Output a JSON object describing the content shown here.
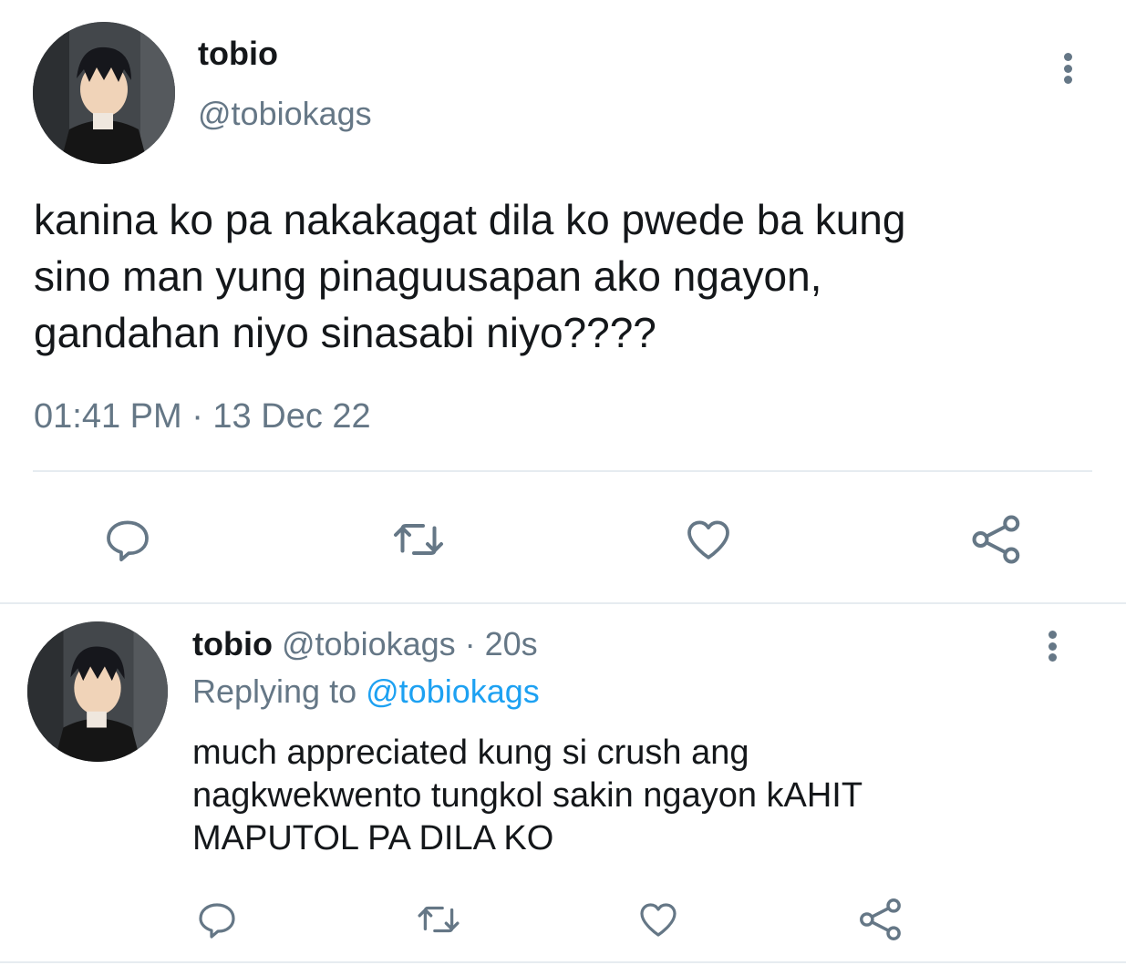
{
  "main_tweet": {
    "display_name": "tobio",
    "handle": "@tobiokags",
    "text_lines": [
      "kanina ko pa nakakagat dila ko pwede ba kung",
      "sino man yung pinaguusapan ako ngayon,",
      "gandahan niyo sinasabi niyo????"
    ],
    "timestamp": "01:41 PM · 13 Dec 22",
    "actions": [
      "reply-icon",
      "retweet-icon",
      "like-icon",
      "share-icon"
    ]
  },
  "reply_tweet": {
    "display_name": "tobio",
    "handle_time": "@tobiokags · 20s",
    "replying_prefix": "Replying to",
    "replying_mention": "@tobiokags",
    "text_lines": [
      "much appreciated kung si crush ang",
      "nagkwekwento tungkol sakin ngayon kAHIT",
      "MAPUTOL PA DILA KO"
    ],
    "actions": [
      "reply-icon",
      "retweet-icon",
      "like-icon",
      "share-icon"
    ]
  },
  "colors": {
    "text": "#14171a",
    "secondary": "#657786",
    "link": "#1da1f2",
    "divider": "#e6ecf0"
  }
}
